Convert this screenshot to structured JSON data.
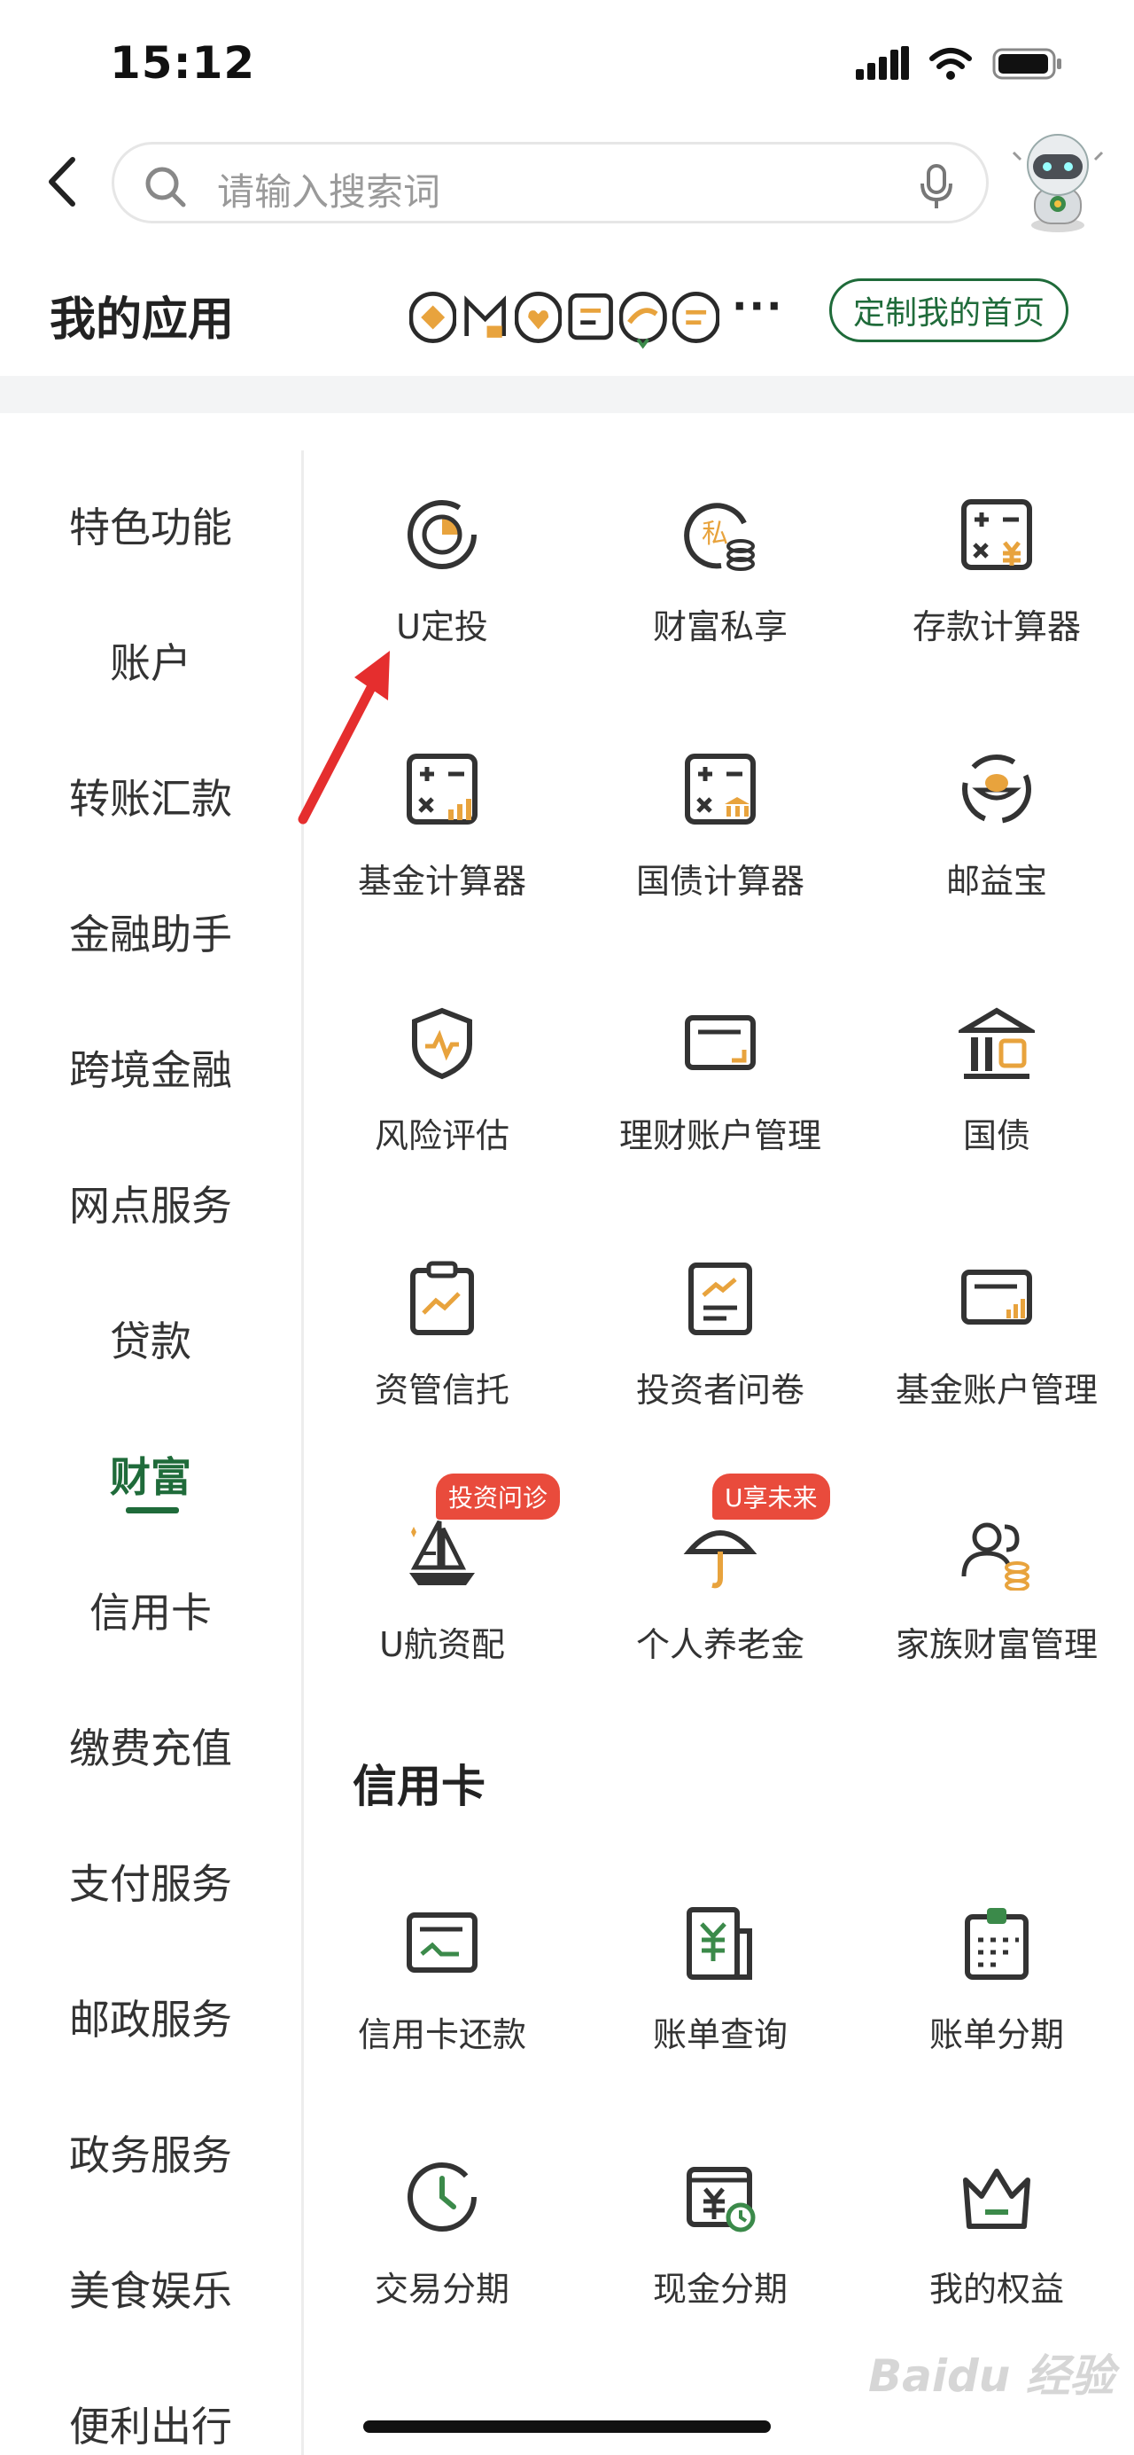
{
  "status_bar": {
    "time": "15:12"
  },
  "search": {
    "placeholder": "请输入搜索词"
  },
  "my_apps": {
    "title": "我的应用",
    "more": "···",
    "customize_label": "定制我的首页"
  },
  "sidebar": {
    "items": [
      {
        "label": "特色功能"
      },
      {
        "label": "账户"
      },
      {
        "label": "转账汇款"
      },
      {
        "label": "金融助手"
      },
      {
        "label": "跨境金融"
      },
      {
        "label": "网点服务"
      },
      {
        "label": "贷款"
      },
      {
        "label": "财富",
        "active": true
      },
      {
        "label": "信用卡"
      },
      {
        "label": "缴费充值"
      },
      {
        "label": "支付服务"
      },
      {
        "label": "邮政服务"
      },
      {
        "label": "政务服务"
      },
      {
        "label": "美食娱乐"
      },
      {
        "label": "便利出行"
      }
    ]
  },
  "wealth_apps": [
    {
      "label": "U定投",
      "icon": "clock-pie-icon"
    },
    {
      "label": "财富私享",
      "icon": "private-coins-icon"
    },
    {
      "label": "存款计算器",
      "icon": "calculator-yuan-icon"
    },
    {
      "label": "基金计算器",
      "icon": "calculator-chart-icon"
    },
    {
      "label": "国债计算器",
      "icon": "calculator-bank-icon"
    },
    {
      "label": "邮益宝",
      "icon": "ingot-cycle-icon"
    },
    {
      "label": "风险评估",
      "icon": "shield-pulse-icon"
    },
    {
      "label": "理财账户管理",
      "icon": "card-account-icon"
    },
    {
      "label": "国债",
      "icon": "bank-building-icon"
    },
    {
      "label": "资管信托",
      "icon": "clipboard-trend-icon"
    },
    {
      "label": "投资者问卷",
      "icon": "document-trend-icon"
    },
    {
      "label": "基金账户管理",
      "icon": "card-chart-icon"
    },
    {
      "label": "U航资配",
      "icon": "sailboat-icon",
      "badge": "投资问诊"
    },
    {
      "label": "个人养老金",
      "icon": "umbrella-icon",
      "badge": "U享未来"
    },
    {
      "label": "家族财富管理",
      "icon": "family-coins-icon"
    }
  ],
  "credit_section": {
    "title": "信用卡",
    "apps": [
      {
        "label": "信用卡还款",
        "icon": "card-repay-icon"
      },
      {
        "label": "账单查询",
        "icon": "bill-query-icon"
      },
      {
        "label": "账单分期",
        "icon": "bill-installment-icon"
      },
      {
        "label": "交易分期",
        "icon": "clock-installment-icon"
      },
      {
        "label": "现金分期",
        "icon": "cash-installment-icon"
      },
      {
        "label": "我的权益",
        "icon": "crown-icon"
      }
    ]
  },
  "watermark": "Baidu 经验",
  "colors": {
    "accent_green": "#1f6b3a",
    "icon_orange": "#e8a33d",
    "badge_red": "#e94b3c",
    "arrow_red": "#e52e2e"
  }
}
